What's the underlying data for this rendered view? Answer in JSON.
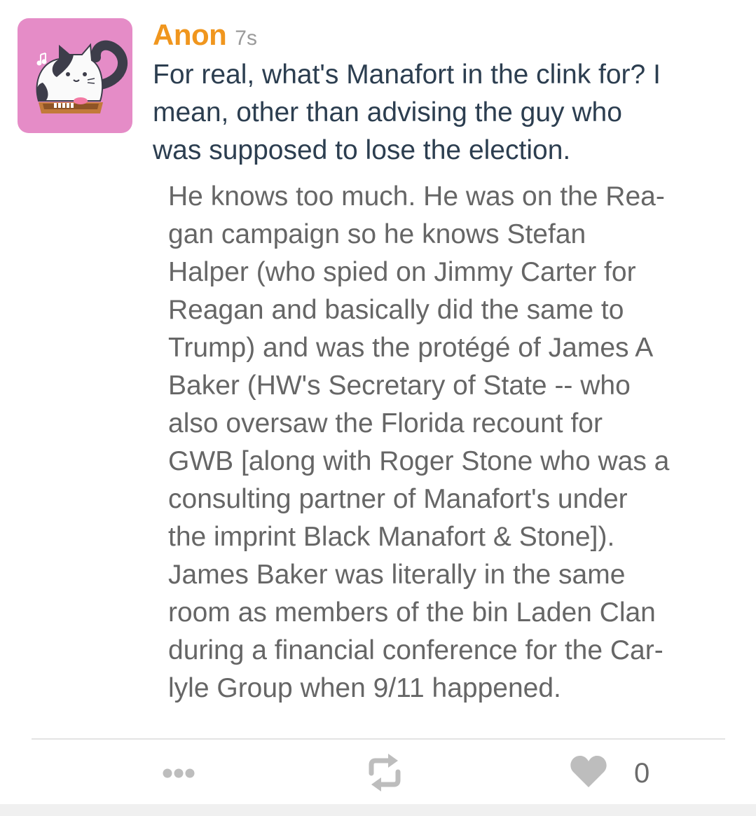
{
  "post": {
    "username": "Anon",
    "timestamp": "7s",
    "question": "For real, what's Manafort in the clink for? I\nmean, other than advising the guy who\nwas supposed to lose the election.",
    "answer": "He knows too much. He was on the Rea-\ngan campaign so he knows Stefan\nHalper (who spied on Jimmy Carter for\nReagan and basically did the same to\nTrump) and was the protégé of James A\nBaker (HW's Secretary of State -- who\nalso oversaw the Florida recount for\nGWB [along with Roger Stone who was a\nconsulting partner of Manafort's under\nthe imprint Black Manafort & Stone]).\nJames Baker was literally in the same\nroom as members of the bin Laden Clan\nduring a financial conference for the Car-\nlyle Group when 9/11 happened."
  },
  "actions": {
    "more_icon": "ellipsis-icon",
    "reblog_icon": "reblog-icon",
    "like_icon": "heart-icon",
    "like_count": "0"
  },
  "colors": {
    "username": "#f0961e",
    "avatar_bg": "#e58cc7",
    "question_text": "#2c3e50",
    "answer_text": "#666666",
    "icon_gray": "#bdbdbd"
  }
}
